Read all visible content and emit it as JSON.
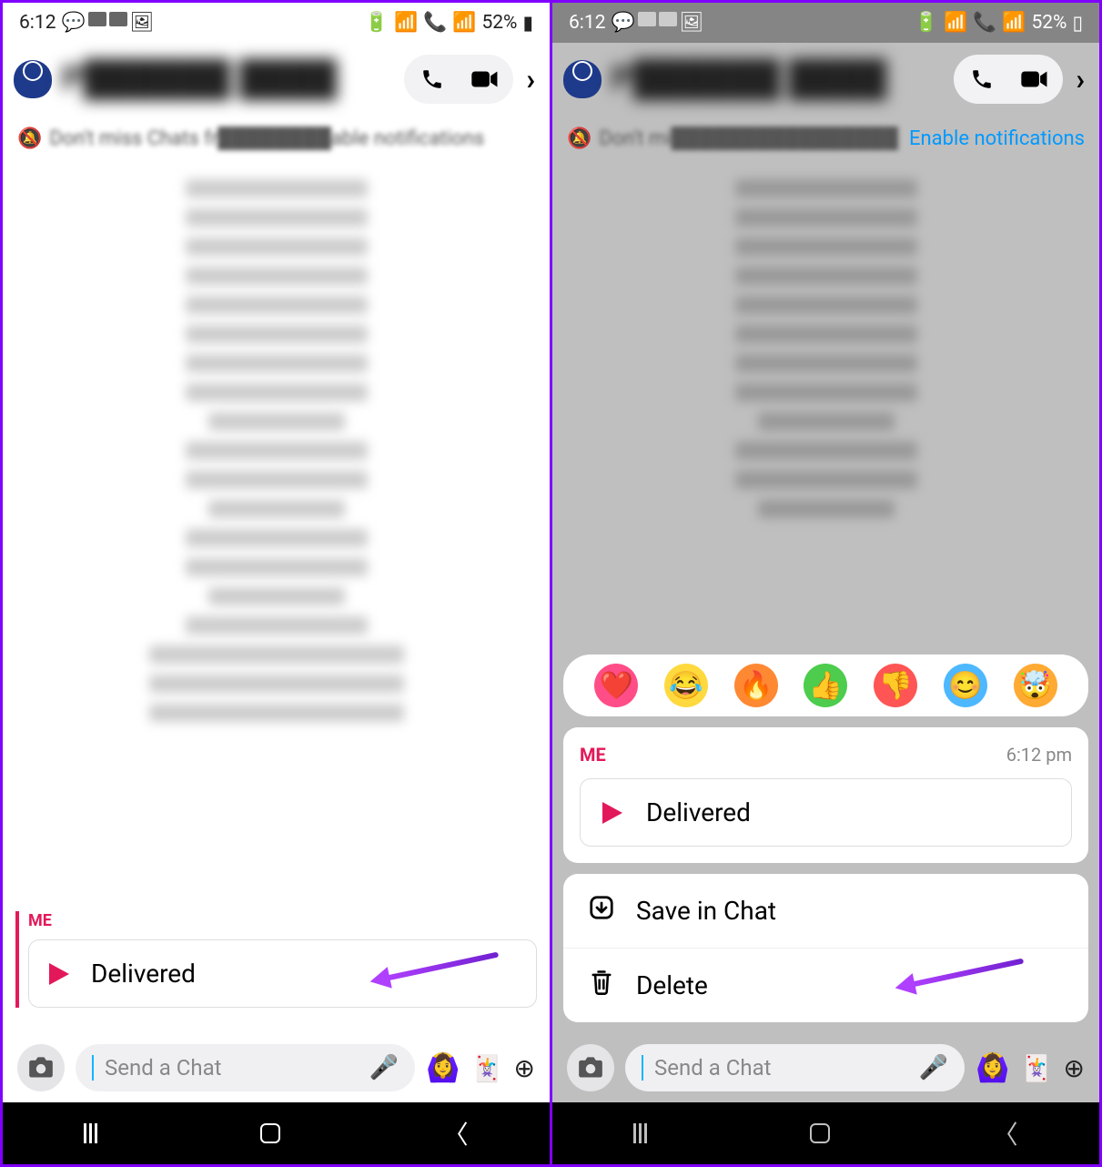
{
  "status": {
    "time": "6:12",
    "battery_pct": "52%"
  },
  "header": {
    "contact_name": "P██████ ████",
    "chevron": "›"
  },
  "notif": {
    "text_prefix": "Don't miss Chats fr",
    "text_suffix": "able notifications",
    "link": "Enable notifications"
  },
  "left": {
    "me_label": "ME",
    "delivered": "Delivered"
  },
  "input": {
    "placeholder": "Send a Chat"
  },
  "right": {
    "notif_text": "Don't mi",
    "popup": {
      "me": "ME",
      "time": "6:12 pm",
      "delivered": "Delivered",
      "save": "Save in Chat",
      "delete": "Delete"
    },
    "reactions": [
      "heart",
      "laugh",
      "fire",
      "thumbs-up",
      "thumbs-down",
      "smile",
      "mind-blown"
    ]
  }
}
